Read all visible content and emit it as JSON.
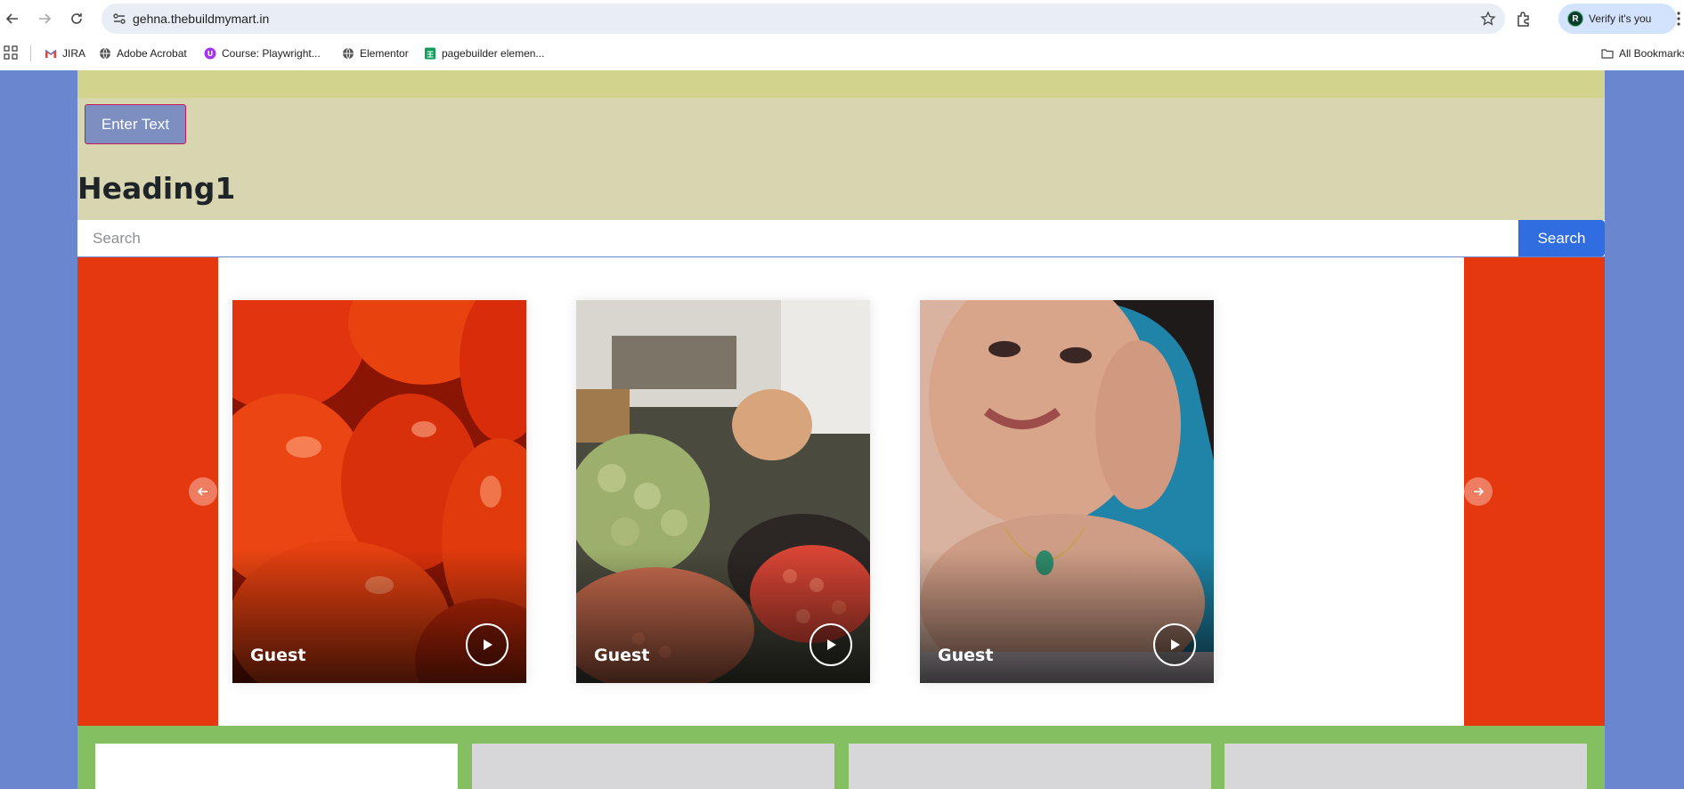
{
  "browser": {
    "url": "gehna.thebuildmymart.in",
    "profile_label": "Verify it's you",
    "profile_initial": "R",
    "bookmarks": [
      {
        "label": "JIRA",
        "icon": "gmail-icon"
      },
      {
        "label": "Adobe Acrobat",
        "icon": "globe-icon"
      },
      {
        "label": "Course: Playwright...",
        "icon": "course-icon"
      },
      {
        "label": "Elementor",
        "icon": "globe-icon"
      },
      {
        "label": "pagebuilder elemen...",
        "icon": "sheets-icon"
      }
    ],
    "all_bookmarks_label": "All Bookmarks"
  },
  "page": {
    "enter_text_button": "Enter Text",
    "heading": "Heading1",
    "search": {
      "placeholder": "Search",
      "button_label": "Search"
    },
    "carousel": {
      "cards": [
        {
          "name": "Guest",
          "image": "tomatoes"
        },
        {
          "name": "Guest",
          "image": "vegetable-market"
        },
        {
          "name": "Guest",
          "image": "woman-with-necklace"
        }
      ]
    }
  },
  "colors": {
    "page_background": "#6a86cf",
    "top_band": "#d2d48d",
    "header_background": "#d8d6b0",
    "carousel_sides": "#e5380f",
    "search_button": "#2f6de0",
    "bottom_section": "#84c062",
    "bottom_card_white": "#ffffff",
    "bottom_card_gray": "#d7d6d8"
  }
}
